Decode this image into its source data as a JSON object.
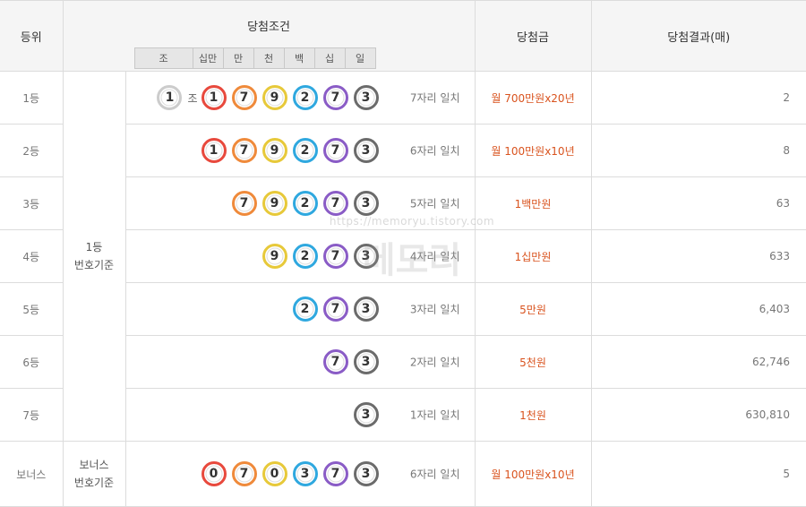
{
  "header": {
    "rank": "등위",
    "condition": "당첨조건",
    "prize": "당첨금",
    "result": "당첨결과(매)",
    "digit_labels": [
      "조",
      "십만",
      "만",
      "천",
      "백",
      "십",
      "일"
    ]
  },
  "ball_colors": {
    "0": "#e8493d",
    "1": "#e8493d",
    "2": "#2fa8df",
    "3": "#6b6b6b",
    "7": "#8a5cc6",
    "9": "#e7c93a",
    "jo": "#cccccc"
  },
  "ball_colors_by_place": {
    "십만": "#e8493d",
    "만": "#ef8a3b",
    "천": "#e7c93a",
    "백": "#2fa8df",
    "십": "#8a5cc6",
    "일": "#6b6b6b",
    "조": "#cccccc"
  },
  "basis": {
    "main": "1등\n번호기준",
    "bonus": "보너스\n번호기준"
  },
  "jo_label": "조",
  "rows": [
    {
      "rank": "1등",
      "jo": "1",
      "balls": [
        "1",
        "7",
        "9",
        "2",
        "7",
        "3"
      ],
      "match": "7자리 일치",
      "prize": "월 700만원x20년",
      "count": "2"
    },
    {
      "rank": "2등",
      "balls": [
        "1",
        "7",
        "9",
        "2",
        "7",
        "3"
      ],
      "match": "6자리 일치",
      "prize": "월 100만원x10년",
      "count": "8"
    },
    {
      "rank": "3등",
      "balls": [
        "7",
        "9",
        "2",
        "7",
        "3"
      ],
      "match": "5자리 일치",
      "prize": "1백만원",
      "count": "63"
    },
    {
      "rank": "4등",
      "balls": [
        "9",
        "2",
        "7",
        "3"
      ],
      "match": "4자리 일치",
      "prize": "1십만원",
      "count": "633"
    },
    {
      "rank": "5등",
      "balls": [
        "2",
        "7",
        "3"
      ],
      "match": "3자리 일치",
      "prize": "5만원",
      "count": "6,403"
    },
    {
      "rank": "6등",
      "balls": [
        "7",
        "3"
      ],
      "match": "2자리 일치",
      "prize": "5천원",
      "count": "62,746"
    },
    {
      "rank": "7등",
      "balls": [
        "3"
      ],
      "match": "1자리 일치",
      "prize": "1천원",
      "count": "630,810"
    },
    {
      "rank": "보너스",
      "balls": [
        "0",
        "7",
        "0",
        "3",
        "7",
        "3"
      ],
      "match": "6자리 일치",
      "prize": "월 100만원x10년",
      "count": "5"
    }
  ],
  "watermark": {
    "url": "https://memoryu.tistory.com",
    "logo": "메모리"
  }
}
